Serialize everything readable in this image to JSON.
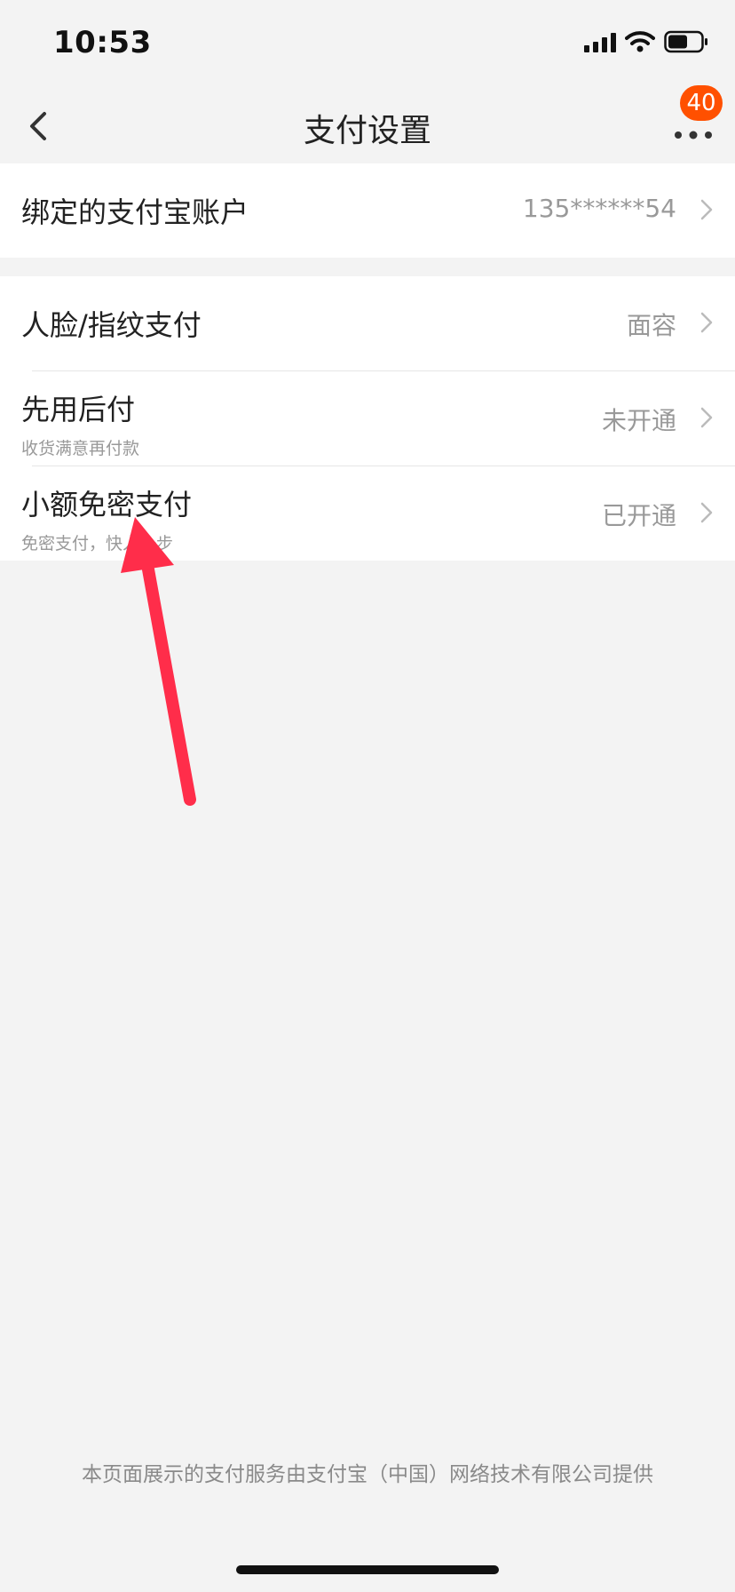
{
  "status": {
    "time": "10:53"
  },
  "nav": {
    "title": "支付设置",
    "badge": "40"
  },
  "account": {
    "label": "绑定的支付宝账户",
    "value": "135******54"
  },
  "settings": [
    {
      "label": "人脸/指纹支付",
      "value": "面容",
      "sub": ""
    },
    {
      "label": "先用后付",
      "value": "未开通",
      "sub": "收货满意再付款"
    },
    {
      "label": "小额免密支付",
      "value": "已开通",
      "sub": "免密支付，快人一步"
    }
  ],
  "footer": "本页面展示的支付服务由支付宝（中国）网络技术有限公司提供",
  "colors": {
    "accent": "#ff5000",
    "arrow": "#ff2d4a",
    "background": "#f3f3f3"
  }
}
